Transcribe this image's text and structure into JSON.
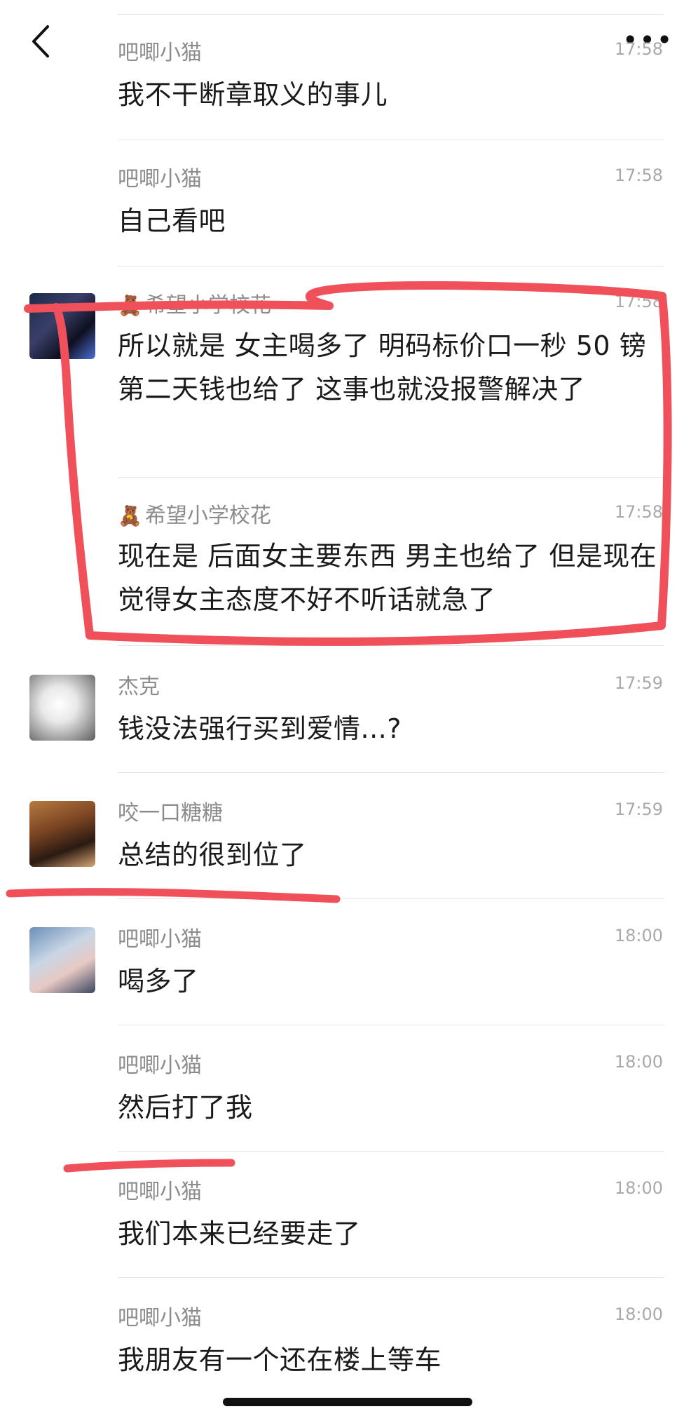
{
  "nav": {
    "back_icon": "chevron-left-icon",
    "more_label": "•••"
  },
  "messages": [
    {
      "sender": "吧唧小猫",
      "time": "17:58",
      "text": "我不干断章取义的事儿",
      "avatar": false
    },
    {
      "sender": "吧唧小猫",
      "time": "17:58",
      "text": "自己看吧",
      "avatar": false
    },
    {
      "sender": "希望小学校花",
      "sender_icon": "🧸",
      "time": "17:58",
      "text": "所以就是 女主喝多了 明码标价口一秒 50 镑 第二天钱也给了 这事也就没报警解决了",
      "avatar": true
    },
    {
      "sender": "希望小学校花",
      "sender_icon": "🧸",
      "time": "17:58",
      "text": "现在是 后面女主要东西 男主也给了 但是现在觉得女主态度不好不听话就急了",
      "avatar": false
    },
    {
      "sender": "杰克",
      "time": "17:59",
      "text": "钱没法强行买到爱情...?",
      "avatar": true
    },
    {
      "sender": "咬一口糖糖",
      "time": "17:59",
      "text": "总结的很到位了",
      "avatar": true
    },
    {
      "sender": "吧唧小猫",
      "time": "18:00",
      "text": "喝多了",
      "avatar": true
    },
    {
      "sender": "吧唧小猫",
      "time": "18:00",
      "text": "然后打了我",
      "avatar": false
    },
    {
      "sender": "吧唧小猫",
      "time": "18:00",
      "text": "我们本来已经要走了",
      "avatar": false
    },
    {
      "sender": "吧唧小猫",
      "time": "18:00",
      "text": "我朋友有一个还在楼上等车",
      "avatar": false
    }
  ],
  "colors": {
    "annotation_red": "#f0505a",
    "name_gray": "#8c8c8c",
    "time_gray": "#a9a9a9",
    "text": "#1a1a1a"
  }
}
